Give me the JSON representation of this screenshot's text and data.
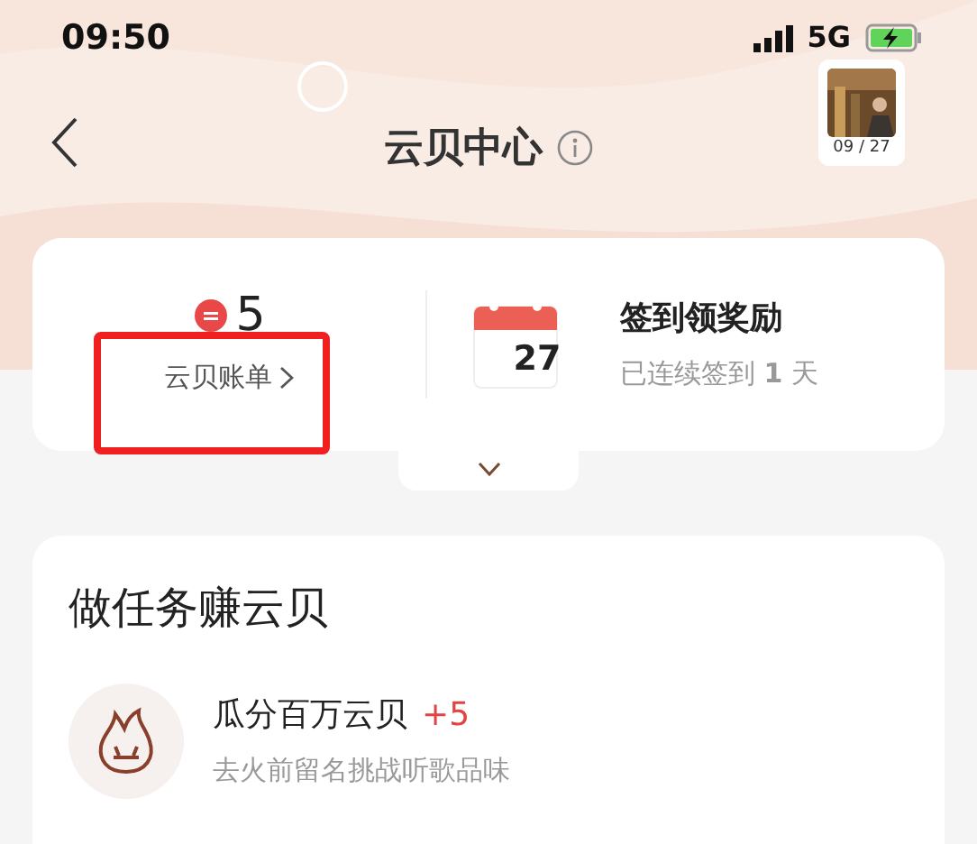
{
  "status_bar": {
    "time": "09:50",
    "network": "5G",
    "charging": true
  },
  "header": {
    "title": "云贝中心",
    "calendar_badge": "09 / 27"
  },
  "balance": {
    "amount": "5",
    "link": "云贝账单",
    "highlighted": true
  },
  "checkin": {
    "day": "27",
    "title": "签到领奖励",
    "streak": "已连续签到 **1** 天"
  },
  "tasks": {
    "title": "做任务赚云贝",
    "items": [
      {
        "title": "瓜分百万云贝",
        "reward": "+5",
        "subtitle": "去火前留名挑战听歌品味"
      }
    ]
  }
}
